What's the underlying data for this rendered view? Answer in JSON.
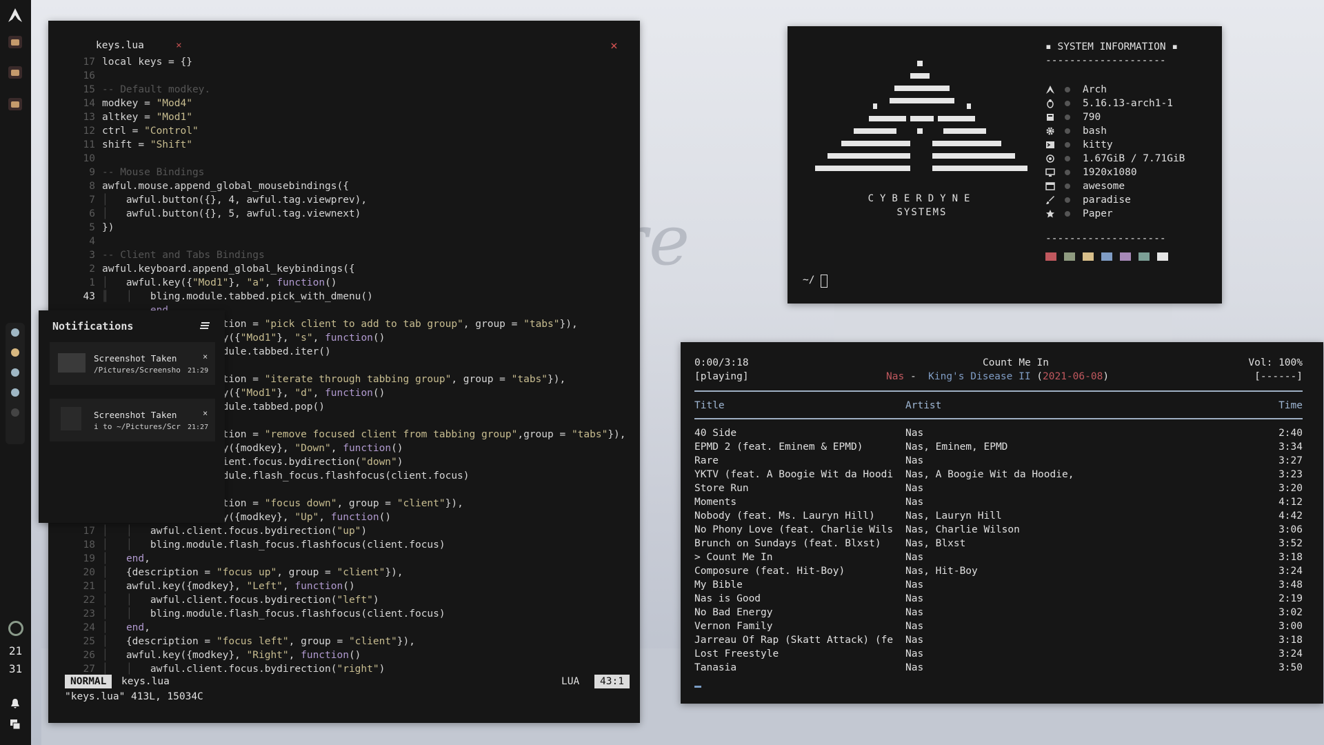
{
  "sidebar": {
    "clock_hour": "21",
    "clock_minute": "31",
    "tag_colors": [
      "#9fb7c4",
      "#d8b880",
      "#9fb7c4",
      "#9fb7c4",
      "#444444"
    ]
  },
  "editor": {
    "tab_name": "keys.lua",
    "tab_close": "×",
    "window_close": "×",
    "lines": [
      {
        "num": "17",
        "code": "local keys = {}",
        "type": "kw"
      },
      {
        "num": "16",
        "code": "",
        "type": "plain"
      },
      {
        "num": "15",
        "code": "-- Default modkey.",
        "type": "com"
      },
      {
        "num": "14",
        "code": "modkey = \"Mod4\"",
        "type": "str"
      },
      {
        "num": "13",
        "code": "altkey = \"Mod1\"",
        "type": "str"
      },
      {
        "num": "12",
        "code": "ctrl = \"Control\"",
        "type": "str"
      },
      {
        "num": "11",
        "code": "shift = \"Shift\"",
        "type": "str"
      },
      {
        "num": "10",
        "code": "",
        "type": "plain"
      },
      {
        "num": "9",
        "code": "-- Mouse Bindings",
        "type": "com"
      },
      {
        "num": "8",
        "code": "awful.mouse.append_global_mousebindings({",
        "type": "plain"
      },
      {
        "num": "7",
        "code": "│   awful.button({}, 4, awful.tag.viewprev),",
        "type": "plain"
      },
      {
        "num": "6",
        "code": "│   awful.button({}, 5, awful.tag.viewnext)",
        "type": "plain"
      },
      {
        "num": "5",
        "code": "})",
        "type": "plain"
      },
      {
        "num": "4",
        "code": "",
        "type": "plain"
      },
      {
        "num": "3",
        "code": "-- Client and Tabs Bindings",
        "type": "com"
      },
      {
        "num": "2",
        "code": "awful.keyboard.append_global_keybindings({",
        "type": "plain"
      },
      {
        "num": "1",
        "code": "│   awful.key({\"Mod1\"}, \"a\", function()",
        "type": "plain"
      },
      {
        "num": "43",
        "code": "║   │   bling.module.tabbed.pick_with_dmenu()",
        "type": "cur"
      },
      {
        "num": "",
        "code": "        end,",
        "type": "plain"
      },
      {
        "num": "",
        "code": "            {description = \"pick client to add to tab group\", group = \"tabs\"}),",
        "type": "plain"
      },
      {
        "num": "",
        "code": "            awful.key({\"Mod1\"}, \"s\", function()",
        "type": "plain"
      },
      {
        "num": "",
        "code": "            bling.module.tabbed.iter()",
        "type": "plain"
      },
      {
        "num": "",
        "code": "        end,",
        "type": "plain"
      },
      {
        "num": "",
        "code": "            {description = \"iterate through tabbing group\", group = \"tabs\"}),",
        "type": "plain"
      },
      {
        "num": "",
        "code": "            awful.key({\"Mod1\"}, \"d\", function()",
        "type": "plain"
      },
      {
        "num": "",
        "code": "            bling.module.tabbed.pop()",
        "type": "plain"
      },
      {
        "num": "",
        "code": "        end,",
        "type": "plain"
      },
      {
        "num": "",
        "code": "            {description = \"remove focused client from tabbing group\",group = \"tabs\"}),",
        "type": "plain"
      },
      {
        "num": "",
        "code": "            awful.key({modkey}, \"Down\", function()",
        "type": "plain"
      },
      {
        "num": "",
        "code": "            awful.client.focus.bydirection(\"down\")",
        "type": "plain"
      },
      {
        "num": "",
        "code": "            bling.module.flash_focus.flashfocus(client.focus)",
        "type": "plain"
      },
      {
        "num": "",
        "code": "        end,",
        "type": "plain"
      },
      {
        "num": "",
        "code": "            {description = \"focus down\", group = \"client\"}),",
        "type": "plain"
      },
      {
        "num": "",
        "code": "            awful.key({modkey}, \"Up\", function()",
        "type": "plain"
      },
      {
        "num": "17",
        "code": "│   │   awful.client.focus.bydirection(\"up\")",
        "type": "plain"
      },
      {
        "num": "18",
        "code": "│   │   bling.module.flash_focus.flashfocus(client.focus)",
        "type": "plain"
      },
      {
        "num": "19",
        "code": "│   end,",
        "type": "plain"
      },
      {
        "num": "20",
        "code": "│   {description = \"focus up\", group = \"client\"}),",
        "type": "plain"
      },
      {
        "num": "21",
        "code": "│   awful.key({modkey}, \"Left\", function()",
        "type": "plain"
      },
      {
        "num": "22",
        "code": "│   │   awful.client.focus.bydirection(\"left\")",
        "type": "plain"
      },
      {
        "num": "23",
        "code": "│   │   bling.module.flash_focus.flashfocus(client.focus)",
        "type": "plain"
      },
      {
        "num": "24",
        "code": "│   end,",
        "type": "plain"
      },
      {
        "num": "25",
        "code": "│   {description = \"focus left\", group = \"client\"}),",
        "type": "plain"
      },
      {
        "num": "26",
        "code": "│   awful.key({modkey}, \"Right\", function()",
        "type": "plain"
      },
      {
        "num": "27",
        "code": "│   │   awful.client.focus.bydirection(\"right\")",
        "type": "plain"
      }
    ],
    "status": {
      "mode": "NORMAL",
      "file": "keys.lua",
      "lang": "LUA",
      "position": "43:1"
    },
    "cmdline": "\"keys.lua\" 413L, 15034C"
  },
  "notifications": {
    "title": "Notifications",
    "items": [
      {
        "title": "Screenshot Taken",
        "body": "/Pictures/Screenshots",
        "time": "21:29",
        "close": "×"
      },
      {
        "title": "Screenshot Taken",
        "body": "i to ~/Pictures/Scree",
        "time": "21:27",
        "close": "×"
      }
    ]
  },
  "sysinfo": {
    "brand_line1": "CYBERDYNE",
    "brand_line2": "SYSTEMS",
    "header": "▪ SYSTEM INFORMATION ▪",
    "divider": "--------------------",
    "rows": [
      {
        "icon": "arch-icon",
        "value": "Arch"
      },
      {
        "icon": "linux-icon",
        "value": "5.16.13-arch1-1"
      },
      {
        "icon": "package-icon",
        "value": "790"
      },
      {
        "icon": "gear-icon",
        "value": "bash"
      },
      {
        "icon": "terminal-icon",
        "value": "kitty"
      },
      {
        "icon": "memory-icon",
        "value": "1.67GiB / 7.71GiB"
      },
      {
        "icon": "monitor-icon",
        "value": "1920x1080"
      },
      {
        "icon": "window-icon",
        "value": "awesome"
      },
      {
        "icon": "brush-icon",
        "value": "paradise"
      },
      {
        "icon": "star-icon",
        "value": "Paper"
      }
    ],
    "palette": [
      "#c0585e",
      "#8f9b80",
      "#d8bf8a",
      "#7f9cc4",
      "#a789b8",
      "#7c9f96",
      "#e6e6e6"
    ],
    "prompt": "~/"
  },
  "music": {
    "elapsed": "0:00/3:18",
    "state": "[playing]",
    "song": "Count Me In",
    "artist": "Nas",
    "separator": "-",
    "album": "King's Disease II",
    "date_open": "(",
    "date": "2021-06-08",
    "date_close": ")",
    "volume": "Vol: 100%",
    "modes": "[------]",
    "headers": {
      "title": "Title",
      "artist": "Artist",
      "time": "Time"
    },
    "tracks": [
      {
        "title": "40 Side",
        "artist": "Nas",
        "time": "2:40"
      },
      {
        "title": "EPMD 2 (feat. Eminem & EPMD)",
        "artist": "Nas, Eminem, EPMD",
        "time": "3:34"
      },
      {
        "title": "Rare",
        "artist": "Nas",
        "time": "3:27"
      },
      {
        "title": "YKTV (feat. A Boogie Wit da Hoodi",
        "artist": "Nas, A Boogie Wit da Hoodie,",
        "time": "3:23"
      },
      {
        "title": "Store Run",
        "artist": "Nas",
        "time": "3:20"
      },
      {
        "title": "Moments",
        "artist": "Nas",
        "time": "4:12"
      },
      {
        "title": "Nobody (feat. Ms. Lauryn Hill)",
        "artist": "Nas, Lauryn Hill",
        "time": "4:42"
      },
      {
        "title": "No Phony Love (feat. Charlie Wils",
        "artist": "Nas, Charlie Wilson",
        "time": "3:06"
      },
      {
        "title": "Brunch on Sundays (feat. Blxst)",
        "artist": "Nas, Blxst",
        "time": "3:52"
      },
      {
        "title": "> Count Me In",
        "artist": " Nas",
        "time": "3:18"
      },
      {
        "title": "Composure (feat. Hit-Boy)",
        "artist": "Nas, Hit-Boy",
        "time": "3:24"
      },
      {
        "title": "My Bible",
        "artist": "Nas",
        "time": "3:48"
      },
      {
        "title": "Nas is Good",
        "artist": "Nas",
        "time": "2:19"
      },
      {
        "title": "No Bad Energy",
        "artist": "Nas",
        "time": "3:02"
      },
      {
        "title": "Vernon Family",
        "artist": "Nas",
        "time": "3:00"
      },
      {
        "title": "Jarreau Of Rap (Skatt Attack) (fe",
        "artist": "Nas",
        "time": "3:18"
      },
      {
        "title": "Lost Freestyle",
        "artist": "Nas",
        "time": "3:24"
      },
      {
        "title": "Tanasia",
        "artist": "Nas",
        "time": "3:50"
      }
    ]
  },
  "wallpaper_text": "ere"
}
